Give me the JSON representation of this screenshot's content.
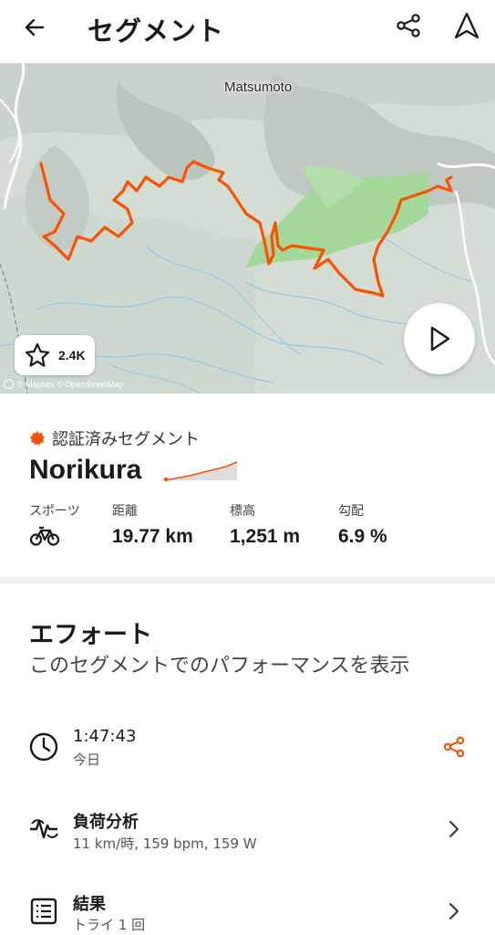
{
  "header": {
    "title": "セグメント",
    "back_icon": "arrow-left-icon",
    "share_icon": "share-icon",
    "navigate_icon": "navigation-arrow-icon"
  },
  "map": {
    "place_label": "Matsumoto",
    "star_count": "2.4K",
    "attribution": "© Mapbox © OpenStreetMap",
    "route_color": "#fc5200"
  },
  "segment": {
    "verified_label": "認証済みセグメント",
    "name": "Norikura",
    "stats": [
      {
        "label": "スポーツ",
        "value": "",
        "icon": "bicycle-icon"
      },
      {
        "label": "距離",
        "value": "19.77 km"
      },
      {
        "label": "標高",
        "value": "1,251 m"
      },
      {
        "label": "勾配",
        "value": "6.9 %"
      }
    ]
  },
  "efforts": {
    "title": "エフォート",
    "subtitle": "このセグメントでのパフォーマンスを表示",
    "rows": [
      {
        "main": "1:47:43",
        "sub": "今日",
        "icon": "clock-icon",
        "action_icon": "share-icon"
      },
      {
        "main": "負荷分析",
        "sub": "11 km/時, 159 bpm, 159 W",
        "icon": "heart-rate-icon",
        "action_icon": "chevron-right-icon"
      },
      {
        "main": "結果",
        "sub": "トライ 1 回",
        "icon": "list-icon",
        "action_icon": "chevron-right-icon"
      }
    ]
  },
  "colors": {
    "accent": "#fc5200",
    "text": "#1a1a1a"
  }
}
